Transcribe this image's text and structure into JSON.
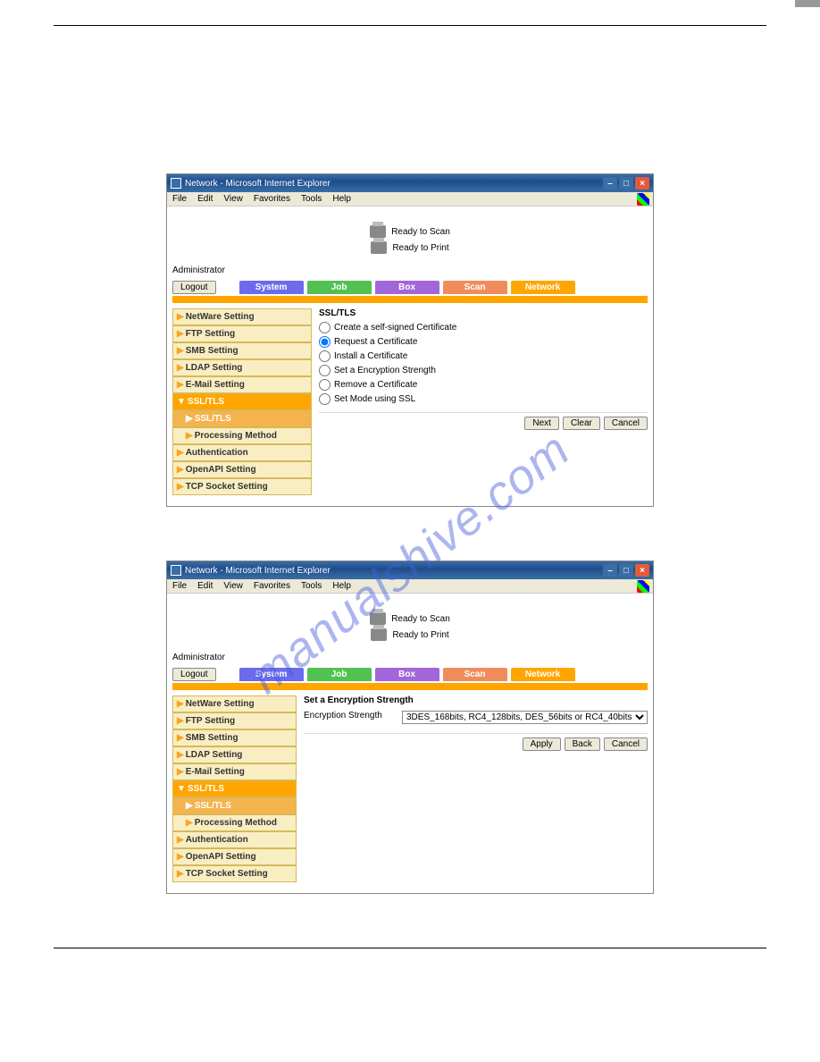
{
  "page": {
    "watermark": "manualshive.com"
  },
  "win": {
    "title": "Network - Microsoft Internet Explorer",
    "menu": [
      "File",
      "Edit",
      "View",
      "Favorites",
      "Tools",
      "Help"
    ],
    "status1": "Ready to Scan",
    "status2": "Ready to Print",
    "admin": "Administrator",
    "logout": "Logout",
    "tabs": {
      "system": "System",
      "job": "Job",
      "box": "Box",
      "scan": "Scan",
      "network": "Network"
    }
  },
  "side": {
    "netware": "NetWare Setting",
    "ftp": "FTP Setting",
    "smb": "SMB Setting",
    "ldap": "LDAP Setting",
    "email": "E-Mail Setting",
    "ssltls_cat": "SSL/TLS",
    "ssltls_item": "SSL/TLS",
    "processing": "Processing Method",
    "auth": "Authentication",
    "openapi": "OpenAPI Setting",
    "tcp": "TCP Socket Setting"
  },
  "ssltls_pane": {
    "title": "SSL/TLS",
    "opt1": "Create a self-signed Certificate",
    "opt2": "Request a Certificate",
    "opt3": "Install a Certificate",
    "opt4": "Set a Encryption Strength",
    "opt5": "Remove a Certificate",
    "opt6": "Set Mode using SSL",
    "next": "Next",
    "clear": "Clear",
    "cancel": "Cancel"
  },
  "enc_pane": {
    "title": "Set a Encryption Strength",
    "label": "Encryption Strength",
    "select": "3DES_168bits, RC4_128bits, DES_56bits or RC4_40bits",
    "apply": "Apply",
    "back": "Back",
    "cancel": "Cancel"
  }
}
